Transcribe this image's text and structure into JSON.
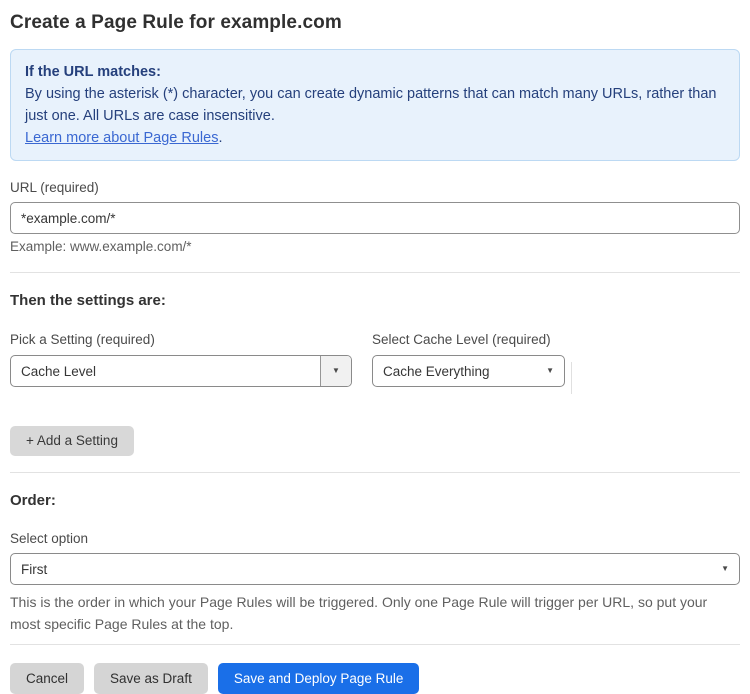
{
  "page": {
    "title": "Create a Page Rule for example.com"
  },
  "info_box": {
    "heading": "If the URL matches:",
    "body": "By using the asterisk (*) character, you can create dynamic patterns that can match many URLs, rather than just one. All URLs are case insensitive.",
    "link_label": "Learn more about Page Rules",
    "link_suffix": "."
  },
  "url_field": {
    "label": "URL (required)",
    "value": "*example.com/*",
    "helper": "Example: www.example.com/*"
  },
  "settings_section": {
    "heading": "Then the settings are:",
    "setting_picker": {
      "label": "Pick a Setting (required)",
      "selected": "Cache Level"
    },
    "cache_level_picker": {
      "label": "Select Cache Level (required)",
      "selected": "Cache Everything"
    },
    "add_setting_label": "+ Add a Setting"
  },
  "order_section": {
    "heading": "Order:",
    "label": "Select option",
    "selected": "First",
    "helper": "This is the order in which your Page Rules will be triggered. Only one Page Rule will trigger per URL, so put your most specific Page Rules at the top."
  },
  "footer": {
    "cancel_label": "Cancel",
    "save_draft_label": "Save as Draft",
    "save_deploy_label": "Save and Deploy Page Rule"
  },
  "icons": {
    "dropdown_arrow": "▼"
  },
  "colors": {
    "primary_button": "#1a6fe8",
    "info_background": "#e8f2fc",
    "info_border": "#bcd9f3",
    "info_text": "#25407c",
    "link": "#3a68d2",
    "gray_button": "#d5d5d5"
  }
}
